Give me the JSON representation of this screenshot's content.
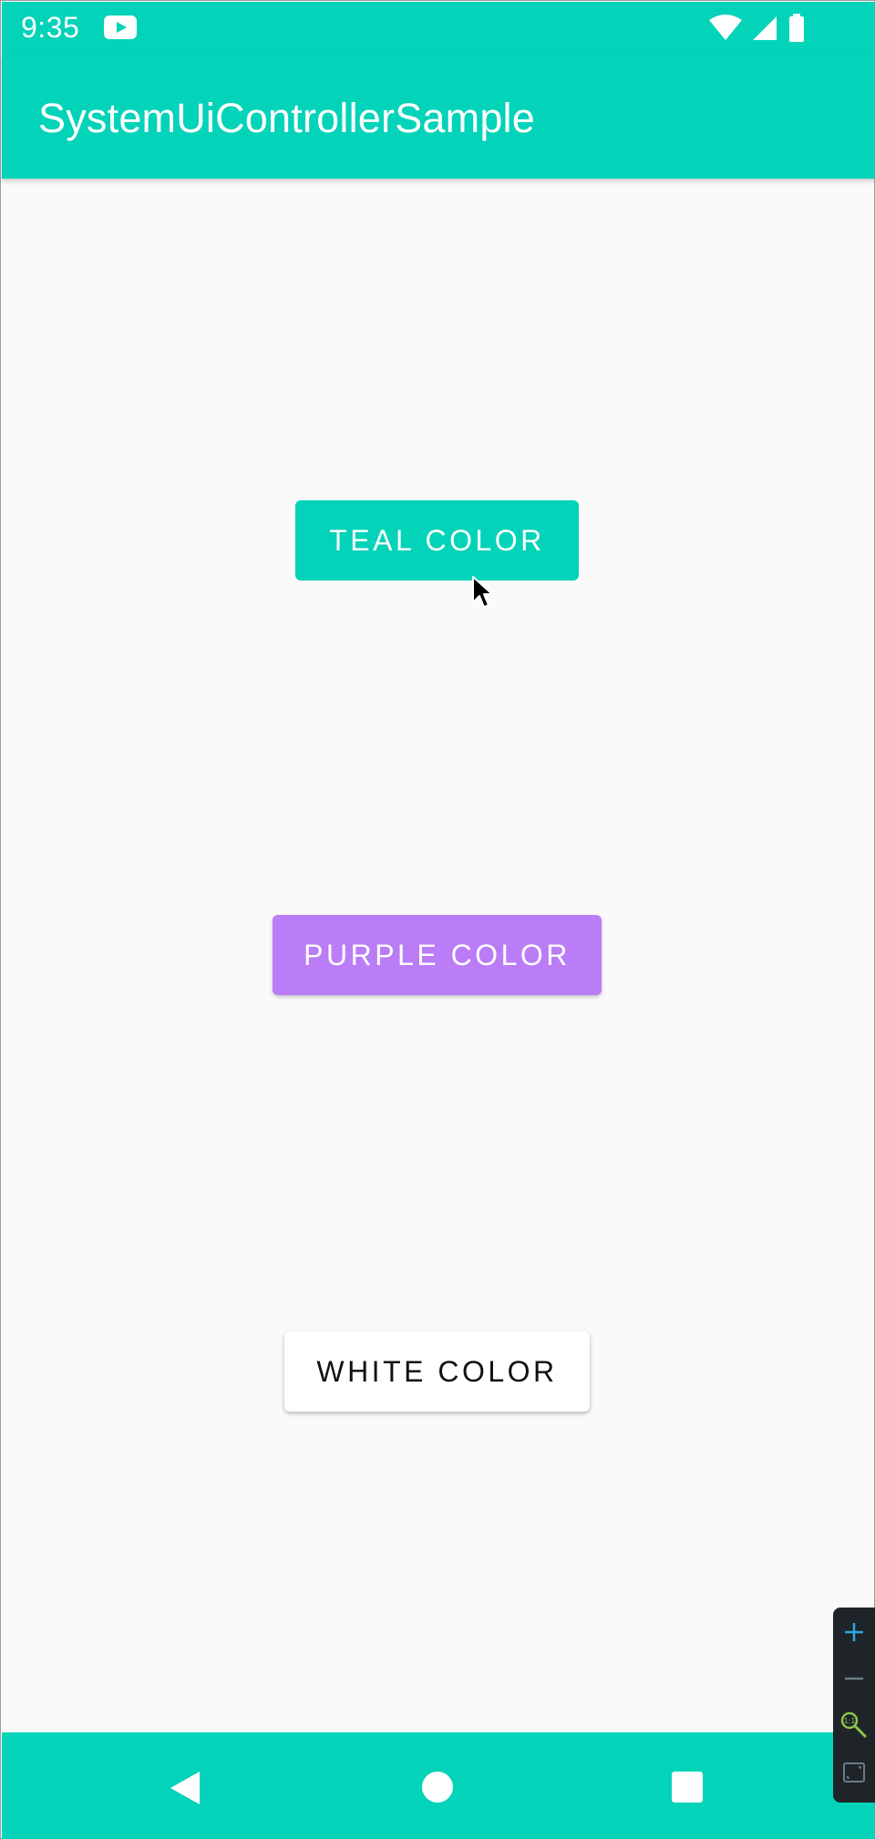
{
  "status_bar": {
    "time": "9:35",
    "icons": [
      "youtube-icon",
      "wifi-icon",
      "signal-icon",
      "battery-icon"
    ]
  },
  "app_bar": {
    "title": "SystemUiControllerSample"
  },
  "buttons": {
    "teal": "TEAL COLOR",
    "purple": "PURPLE COLOR",
    "white": "WHITE COLOR"
  },
  "nav_bar": {
    "icons": [
      "back-icon",
      "home-icon",
      "recents-icon"
    ]
  },
  "zoom_panel": {
    "icons": [
      "zoom-in-icon",
      "zoom-out-icon",
      "zoom-actual-size-icon",
      "fit-to-screen-icon"
    ]
  },
  "colors": {
    "teal": "#03d3b8",
    "purple": "#bb7cf7",
    "white": "#ffffff",
    "background": "#fafafa"
  }
}
